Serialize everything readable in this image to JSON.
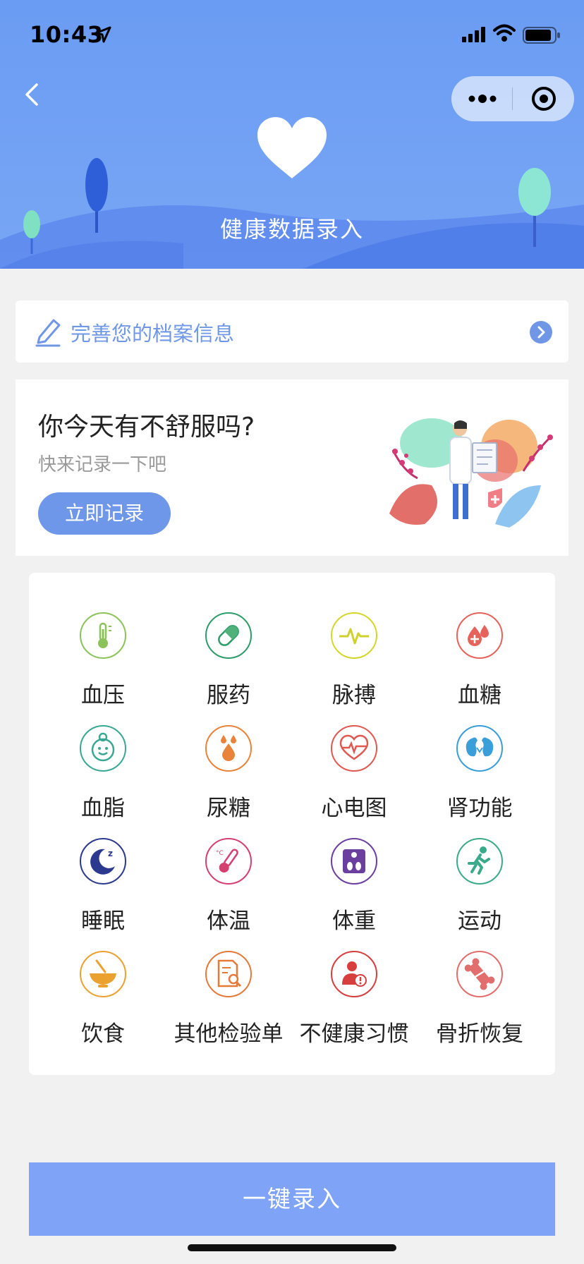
{
  "status_bar": {
    "time": "10:43"
  },
  "header": {
    "title": "健康数据录入"
  },
  "profile_bar": {
    "text": "完善您的档案信息"
  },
  "ask_card": {
    "title": "你今天有不舒服吗?",
    "subtitle": "快来记录一下吧",
    "button_label": "立即记录"
  },
  "grid": {
    "items": [
      {
        "label": "血压",
        "icon": "thermometer-icon",
        "color": "#8cc25a"
      },
      {
        "label": "服药",
        "icon": "pill-icon",
        "color": "#2e9c6a"
      },
      {
        "label": "脉搏",
        "icon": "pulse-icon",
        "color": "#d4d62a"
      },
      {
        "label": "血糖",
        "icon": "blood-drop-icon",
        "color": "#e5635b"
      },
      {
        "label": "血脂",
        "icon": "smiley-cloud-icon",
        "color": "#38a895"
      },
      {
        "label": "尿糖",
        "icon": "droplets-icon",
        "color": "#e9833a"
      },
      {
        "label": "心电图",
        "icon": "heart-ecg-icon",
        "color": "#e0584f"
      },
      {
        "label": "肾功能",
        "icon": "kidney-icon",
        "color": "#3a9ed9"
      },
      {
        "label": "睡眠",
        "icon": "moon-icon",
        "color": "#2b3a8f"
      },
      {
        "label": "体温",
        "icon": "temperature-icon",
        "color": "#d64070"
      },
      {
        "label": "体重",
        "icon": "scale-icon",
        "color": "#6a3fa0"
      },
      {
        "label": "运动",
        "icon": "runner-icon",
        "color": "#3aaa8a"
      },
      {
        "label": "饮食",
        "icon": "bowl-icon",
        "color": "#eba12f"
      },
      {
        "label": "其他检验单",
        "icon": "report-search-icon",
        "color": "#e47a3a"
      },
      {
        "label": "不健康习惯",
        "icon": "person-warning-icon",
        "color": "#d73e3e"
      },
      {
        "label": "骨折恢复",
        "icon": "bone-icon",
        "color": "#e26d6d"
      }
    ]
  },
  "submit_button": {
    "label": "一键录入"
  }
}
